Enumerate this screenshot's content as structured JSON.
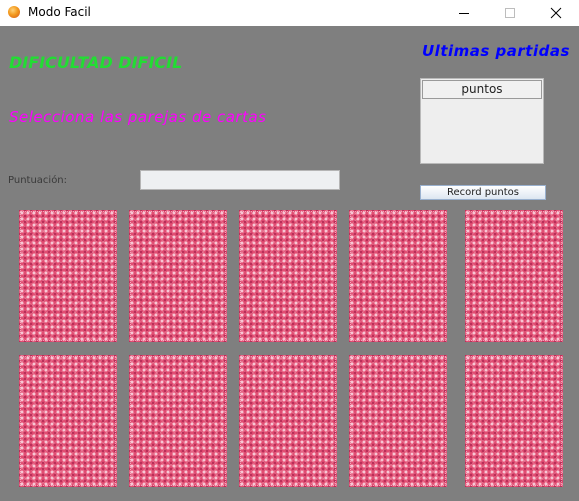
{
  "window": {
    "title": "Modo Facil"
  },
  "game": {
    "difficulty": "DIFICULTAD DIFICIL",
    "instruction": "Selecciona las parejas de cartas",
    "score_label": "Puntuación:",
    "score_value": ""
  },
  "recent": {
    "title": "Ultimas partidas",
    "column_header": "puntos",
    "record_button": "Record puntos"
  },
  "cards": {
    "count": 10,
    "state": "face-down"
  },
  "colors": {
    "background": "#7f7f7f",
    "difficulty_text": "#22dd33",
    "instruction_text": "#ff00ff",
    "recent_title_text": "#0000ff",
    "card_back": "#e24d72"
  },
  "icons": {
    "app": "java-coffee-icon",
    "minimize": "minimize-icon",
    "maximize": "maximize-icon",
    "close": "close-icon"
  }
}
